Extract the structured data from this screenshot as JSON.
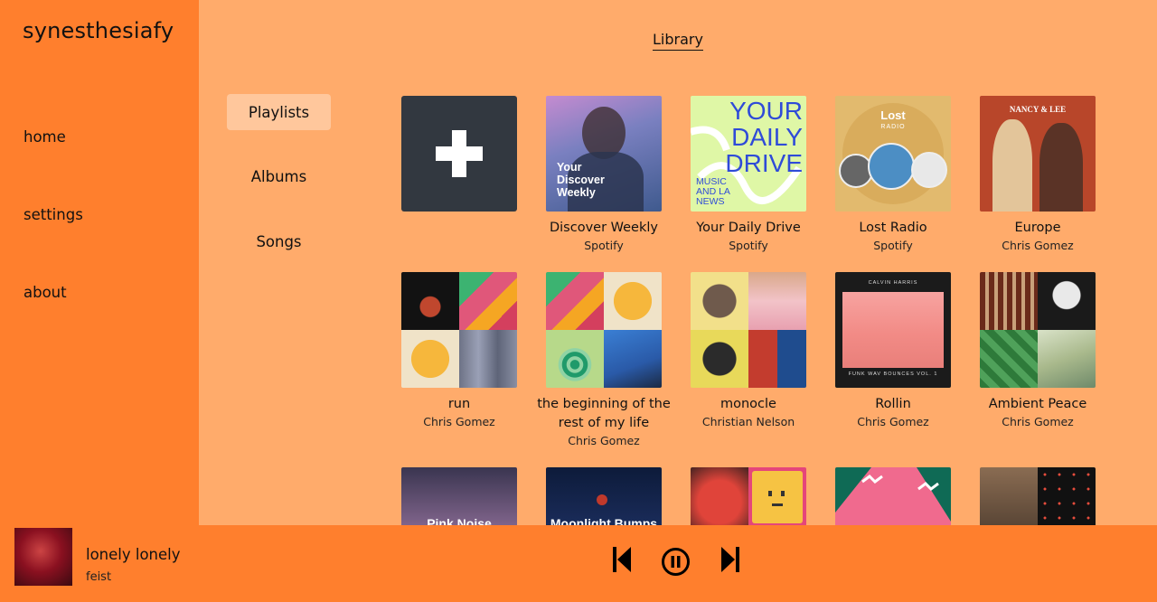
{
  "app": {
    "brand": "synesthesiafy"
  },
  "nav": {
    "home": "home",
    "settings": "settings",
    "about": "about"
  },
  "library": {
    "title": "Library"
  },
  "categories": {
    "playlists": "Playlists",
    "albums": "Albums",
    "songs": "Songs",
    "active": "Playlists"
  },
  "playlists": [
    {
      "name": "",
      "owner": "",
      "icon": "plus-icon"
    },
    {
      "name": "Discover Weekly",
      "owner": "Spotify",
      "cover_text": "Your Discover Weekly"
    },
    {
      "name": "Your Daily Drive",
      "owner": "Spotify",
      "cover_text": "YOUR DAILY DRIVE",
      "cover_sub": "MUSIC AND LA NEWS"
    },
    {
      "name": "Lost Radio",
      "owner": "Spotify",
      "cover_text": "Lost",
      "cover_sub": "RADIO"
    },
    {
      "name": "Europe",
      "owner": "Chris Gomez",
      "cover_text": "NANCY & LEE"
    },
    {
      "name": "run",
      "owner": "Chris Gomez"
    },
    {
      "name": "the beginning of the rest of my life",
      "owner": "Chris Gomez"
    },
    {
      "name": "monocle",
      "owner": "Christian Nelson"
    },
    {
      "name": "Rollin",
      "owner": "Chris Gomez",
      "cover_text": "CALVIN HARRIS",
      "cover_sub": "FUNK WAV BOUNCES VOL. 1"
    },
    {
      "name": "Ambient Peace",
      "owner": "Chris Gomez"
    },
    {
      "name": "",
      "owner": "",
      "cover_text": "Pink Noise"
    },
    {
      "name": "",
      "owner": "",
      "cover_text": "Moonlight Bumps"
    },
    {
      "name": "",
      "owner": ""
    },
    {
      "name": "",
      "owner": ""
    },
    {
      "name": "",
      "owner": ""
    }
  ],
  "now_playing": {
    "title": "lonely lonely",
    "artist": "feist"
  },
  "controls": {
    "previous": "skip-previous-icon",
    "pause": "pause-icon",
    "next": "skip-next-icon"
  },
  "colors": {
    "sidebar": "#ff7f2d",
    "background": "#ffab6b",
    "active_category": "#ffc79c",
    "add_tile": "#323840"
  }
}
